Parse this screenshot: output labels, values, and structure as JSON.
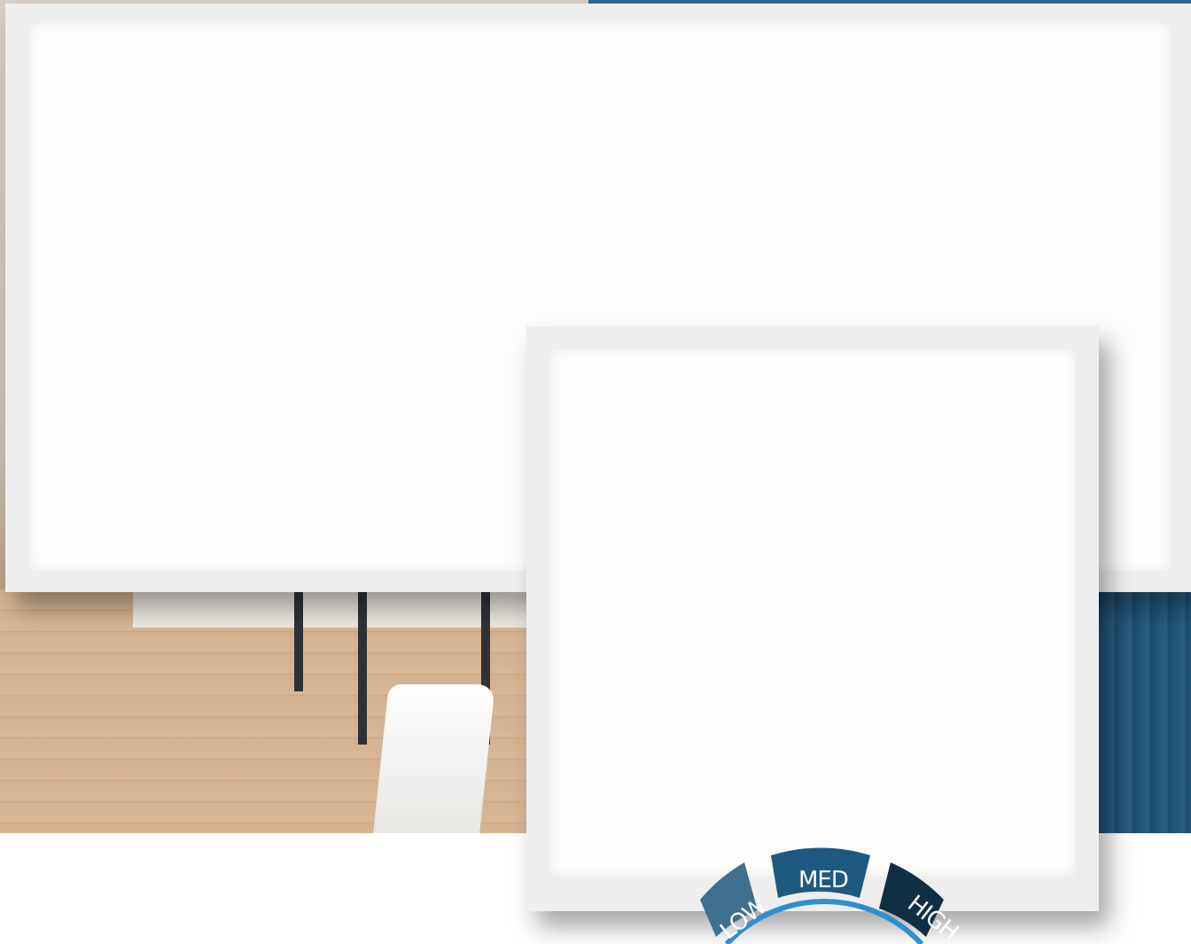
{
  "dial": {
    "segments": [
      {
        "label": "LOW",
        "color": "#3f6f8f"
      },
      {
        "label": "MED",
        "color": "#1e5a80"
      },
      {
        "label": "HIGH",
        "color": "#0f2f45"
      }
    ],
    "accent": "#2f8fd0"
  }
}
